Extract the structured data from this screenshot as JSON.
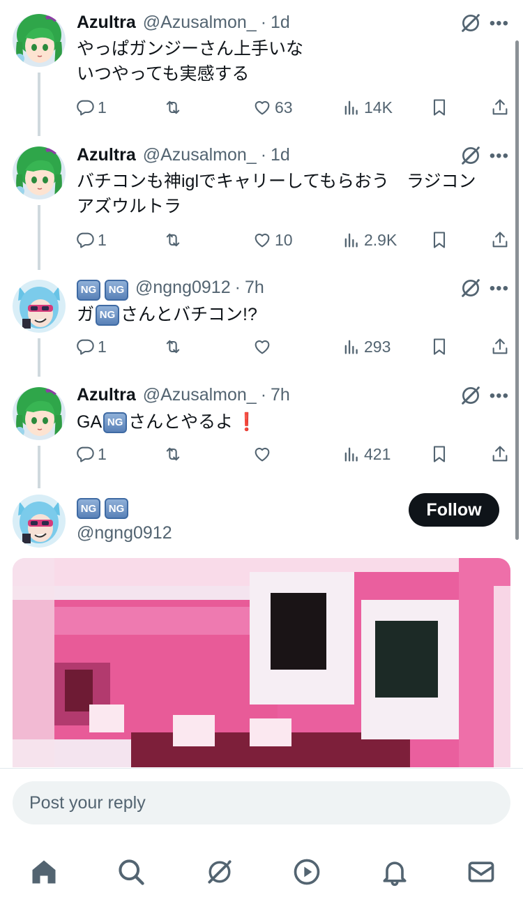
{
  "tweets": [
    {
      "name": "Azultra",
      "handle": "@Azusalmon_",
      "time": "1d",
      "text_lines": [
        "やっぱガンジーさん上手いな",
        "いつやっても実感する"
      ],
      "replies": "1",
      "likes": "63",
      "views": "14K"
    },
    {
      "name": "Azultra",
      "handle": "@Azusalmon_",
      "time": "1d",
      "text_lines": [
        "バチコンも神iglでキャリーしてもらおう　ラジコン",
        "アズウルトラ"
      ],
      "replies": "1",
      "likes": "10",
      "views": "2.9K"
    },
    {
      "name_badges": [
        "NG",
        "NG"
      ],
      "handle": "@ngng0912",
      "time": "7h",
      "text_prefix": "ガ",
      "text_badge": "NG",
      "text_suffix": "さんとバチコン!?",
      "replies": "1",
      "likes": "",
      "views": "293"
    },
    {
      "name": "Azultra",
      "handle": "@Azusalmon_",
      "time": "7h",
      "text_prefix": "GA",
      "text_badge": "NG",
      "text_suffix": "さんとやるよ",
      "text_emoji": "❗",
      "replies": "1",
      "likes": "",
      "views": "421"
    }
  ],
  "profile_card": {
    "badges": [
      "NG",
      "NG"
    ],
    "handle": "@ngng0912",
    "follow_label": "Follow"
  },
  "separator": "·",
  "more_label": "•••",
  "reply_placeholder": "Post your reply",
  "nav": [
    "home-icon",
    "search-icon",
    "grok-icon",
    "video-icon",
    "bell-icon",
    "mail-icon"
  ],
  "colors": {
    "text": "#0f1419",
    "muted": "#536471",
    "line": "#cfd9de",
    "follow_bg": "#0f1419",
    "input_bg": "#eff3f4"
  }
}
